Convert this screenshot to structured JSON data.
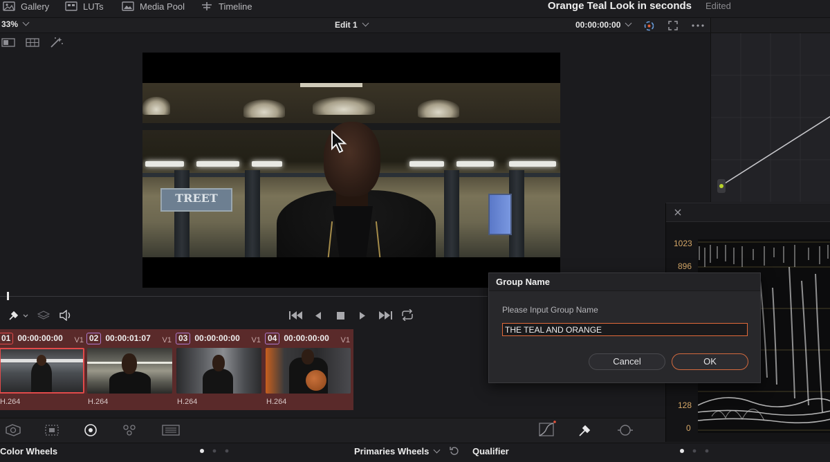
{
  "nav": {
    "tabs": [
      {
        "label": "Gallery",
        "icon": "gallery-icon"
      },
      {
        "label": "LUTs",
        "icon": "luts-icon"
      },
      {
        "label": "Media Pool",
        "icon": "media-pool-icon"
      },
      {
        "label": "Timeline",
        "icon": "timeline-icon"
      }
    ],
    "project_title": "Orange Teal Look in seconds",
    "project_status": "Edited"
  },
  "viewer": {
    "zoom": "33%",
    "edit_name": "Edit 1",
    "timecode": "00:00:00:00",
    "sign_text": "TREET"
  },
  "clips": [
    {
      "number": "01",
      "timecode": "00:00:00:00",
      "track": "V1",
      "codec": "H.264",
      "color": "#e24a4a"
    },
    {
      "number": "02",
      "timecode": "00:00:01:07",
      "track": "V1",
      "codec": "H.264",
      "color": "#b07ad0"
    },
    {
      "number": "03",
      "timecode": "00:00:00:00",
      "track": "V1",
      "codec": "H.264",
      "color": "#b07ad0"
    },
    {
      "number": "04",
      "timecode": "00:00:00:00",
      "track": "V1",
      "codec": "H.264",
      "color": "#b07ad0"
    }
  ],
  "bottom": {
    "color_wheels_label": "Color Wheels",
    "primaries_label": "Primaries Wheels",
    "qualifier_label": "Qualifier"
  },
  "scopes": {
    "ticks": [
      "1023",
      "896",
      "128",
      "0"
    ]
  },
  "dialog": {
    "title": "Group Name",
    "prompt": "Please Input Group Name",
    "input_value": "THE TEAL AND ORANGE",
    "cancel_label": "Cancel",
    "ok_label": "OK"
  },
  "colors": {
    "accent_orange": "#e26a3a",
    "clip_strip": "#5a2a2a",
    "curve_node": "#b7d32a"
  }
}
